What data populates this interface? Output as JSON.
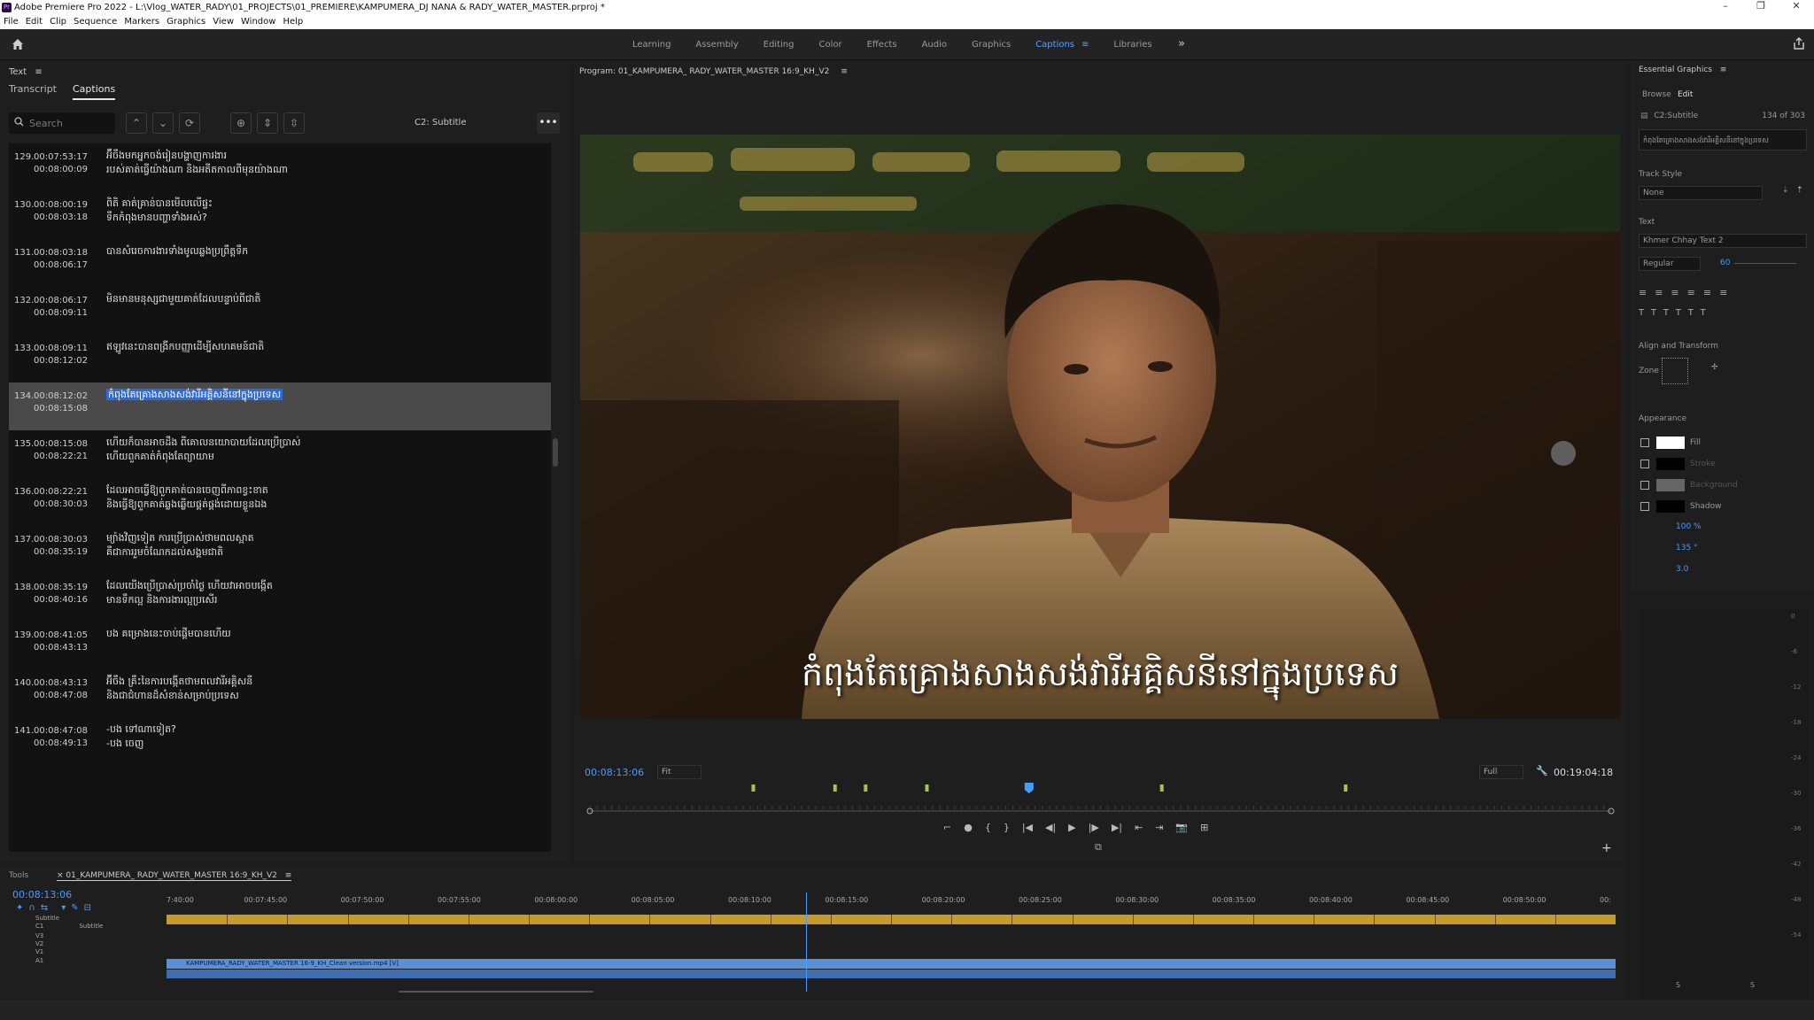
{
  "titlebar": {
    "app_icon": "Pr",
    "title": "Adobe Premiere Pro 2022 - L:\\Vlog_WATER_RADY\\01_PROJECTS\\01_PREMIERE\\KAMPUMERA_DJ NANA & RADY_WATER_MASTER.prproj *",
    "controls": [
      "–",
      "❐",
      "✕"
    ]
  },
  "menu": [
    "File",
    "Edit",
    "Clip",
    "Sequence",
    "Markers",
    "Graphics",
    "View",
    "Window",
    "Help"
  ],
  "workspaces": [
    {
      "label": "Learning"
    },
    {
      "label": "Assembly"
    },
    {
      "label": "Editing"
    },
    {
      "label": "Color"
    },
    {
      "label": "Effects"
    },
    {
      "label": "Audio"
    },
    {
      "label": "Graphics"
    },
    {
      "label": "Captions",
      "active": true
    },
    {
      "label": "Libraries"
    }
  ],
  "workspace_menu_icon": "≡",
  "more_icon": "»",
  "text_panel": {
    "title": "Text",
    "tabs": [
      {
        "label": "Transcript"
      },
      {
        "label": "Captions",
        "active": true
      }
    ],
    "search_placeholder": "Search",
    "track_label": "C2: Subtitle",
    "more": "•••"
  },
  "captions": [
    {
      "num": "129.",
      "in": "00:07:53:17",
      "out": "00:08:00:09",
      "lines": [
        "អ៊ីចឹងមកអ្នកចង់រៀនបង្ហាញការងារ",
        "របស់គាត់ធ្វើយ៉ាងណា និងអតីតកាលពីមុនយ៉ាងណា"
      ]
    },
    {
      "num": "130.",
      "in": "00:08:00:19",
      "out": "00:08:03:18",
      "lines": [
        "ពិតិ គាត់គ្រាន់បានមើលលើផ្ទះ",
        "ទឹកកំពុងមានបញ្ហាទាំងអស់?"
      ]
    },
    {
      "num": "131.",
      "in": "00:08:03:18",
      "out": "00:08:06:17",
      "lines": [
        "បានសំរេចការងារទាំងមូលឆ្លងប្រព្រឹត្តទឹក"
      ]
    },
    {
      "num": "132.",
      "in": "00:08:06:17",
      "out": "00:08:09:11",
      "lines": [
        "មិនមានមនុស្សជាមួយគាត់ដែលបន្ទាប់ពីជាតិ"
      ]
    },
    {
      "num": "133.",
      "in": "00:08:09:11",
      "out": "00:08:12:02",
      "lines": [
        "ឥឡូវនេះបានពង្រីកបញ្ញាដើម្បីសហគមន៍ជាតិ"
      ]
    },
    {
      "num": "134.",
      "in": "00:08:12:02",
      "out": "00:08:15:08",
      "lines": [
        "កំពុងតែគ្រោងសាងសង់វារីអគ្គិសនីនៅក្នុងប្រទេស"
      ],
      "selected": true
    },
    {
      "num": "135.",
      "in": "00:08:15:08",
      "out": "00:08:22:21",
      "lines": [
        "ហើយក៏បានអាចដឹង ពីគោលនយោបាយដែលប្រើប្រាស់",
        "ហើយពួកគាត់កំពុងតែព្យាយាម"
      ]
    },
    {
      "num": "136.",
      "in": "00:08:22:21",
      "out": "00:08:30:03",
      "lines": [
        "ដែលអាចធ្វើឱ្យពួកគាត់បានចេញពីភាពខ្វះខាត",
        "និងធ្វើឱ្យពួកគាត់ឆ្លងឆ្លើយផ្គត់ផ្គង់ដោយខ្លួនឯង"
      ]
    },
    {
      "num": "137.",
      "in": "00:08:30:03",
      "out": "00:08:35:19",
      "lines": [
        "ម្យ៉ាងវិញទៀត ការប្រើប្រាស់ថាមពលស្អាត",
        "គឺជាការរួមចំណែកដល់សង្គមជាតិ"
      ]
    },
    {
      "num": "138.",
      "in": "00:08:35:19",
      "out": "00:08:40:16",
      "lines": [
        "ដែលយើងប្រើប្រាស់ប្រចាំថ្ងៃ ហើយវាអាចបង្កើត",
        "មានទឹកល្អ និងការងារល្អប្រសើរ"
      ]
    },
    {
      "num": "139.",
      "in": "00:08:41:05",
      "out": "00:08:43:13",
      "lines": [
        "បង គម្រោងនេះចាប់ផ្តើមបានហើយ"
      ]
    },
    {
      "num": "140.",
      "in": "00:08:43:13",
      "out": "00:08:47:08",
      "lines": [
        "អ៊ីចឹង គ្រឹះនៃការបង្កើតថាមពលវារីអគ្គិសនី",
        "និងជាជំហានដ៏សំខាន់សម្រាប់ប្រទេស"
      ]
    },
    {
      "num": "141.",
      "in": "00:08:47:08",
      "out": "00:08:49:13",
      "lines": [
        "-បង ទៅណាទៀត?",
        "-បង ចេញ"
      ]
    }
  ],
  "program": {
    "title": "Program: 01_KAMPUMERA_ RADY_WATER_MASTER 16:9_KH_V2",
    "menu_icon": "≡",
    "subtitle": "កំពុងតែគ្រោងសាងសង់វារីអគ្គិសនីនៅក្នុងប្រទេស",
    "timecode": "00:08:13:06",
    "zoom": "Fit",
    "resolution": "Full",
    "duration": "00:19:04:18",
    "playhead_fraction": 0.43,
    "marker_fractions": [
      0.16,
      0.24,
      0.27,
      0.33,
      0.56,
      0.74
    ]
  },
  "transport": [
    "⌐",
    "●",
    "{",
    "}",
    "|◀",
    "◀|",
    "▶",
    "|▶",
    "▶|",
    "⇤",
    "⇥",
    "📷",
    "⊞"
  ],
  "essential_graphics": {
    "title": "Essential Graphics",
    "tabs": [
      "Browse",
      "Edit"
    ],
    "layer": "C2:Subtitle",
    "count": "134 of 303",
    "preview": "កំពុងតែគ្រោងសាងសង់វារីអគ្គិសនីនៅក្នុងប្រទេស",
    "track_style_label": "Track Style",
    "track_style": "None",
    "text_label": "Text",
    "font": "Khmer Chhay Text 2",
    "weight": "Regular",
    "size": "60",
    "align_label": "Align and Transform",
    "zone": "Zone",
    "appearance_label": "Appearance",
    "fill": "Fill",
    "stroke": "Stroke",
    "background": "Background",
    "shadow": "Shadow",
    "shadow_opacity": "100 %",
    "shadow_angle": "135 °",
    "shadow_distance": "3.0",
    "meter_labels": [
      "0",
      "-6",
      "-12",
      "-18",
      "-24",
      "-30",
      "-36",
      "-42",
      "-48",
      "-54"
    ],
    "solo": "S"
  },
  "timeline": {
    "tools_label": "Tools",
    "sequence": "01_KAMPUMERA_ RADY_WATER_MASTER 16:9_KH_V2",
    "timecode": "00:08:13:06",
    "ruler": [
      "7:40:00",
      "00:07:45:00",
      "00:07:50:00",
      "00:07:55:00",
      "00:08:00:00",
      "00:08:05:00",
      "00:08:10:00",
      "00:08:15:00",
      "00:08:20:00",
      "00:08:25:00",
      "00:08:30:00",
      "00:08:35:00",
      "00:08:40:00",
      "00:08:45:00",
      "00:08:50:00",
      "00:"
    ],
    "tracks": [
      {
        "name": "Subtitle"
      },
      {
        "name": "C1",
        "sub": "Subtitle"
      },
      {
        "name": "V3"
      },
      {
        "name": "V2"
      },
      {
        "name": "V1"
      },
      {
        "name": "A1"
      }
    ],
    "clip": "KAMPUMERA_RADY_WATER_MASTER 16-9_KH_Clean version.mp4 [V]",
    "playhead_fraction": 0.44
  },
  "colors": {
    "accent": "#4a9bff",
    "selection": "#2f6bd6",
    "caption_clip": "#c89a2a",
    "video_clip": "#5b8fd6"
  }
}
